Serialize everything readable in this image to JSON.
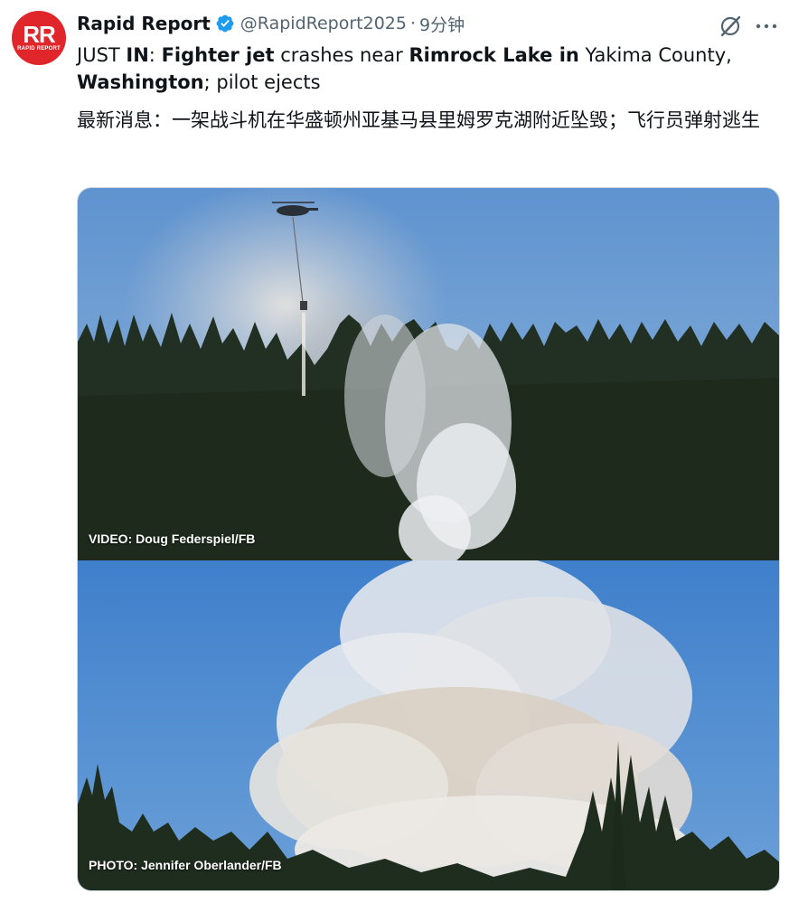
{
  "tweet": {
    "display_name": "Rapid Report",
    "handle": "@RapidReport2025",
    "separator": "·",
    "time": "9分钟",
    "avatar": {
      "initials": "RR",
      "sub_text": "RAPID REPORT",
      "color": "#e0262b"
    },
    "text_segments": [
      {
        "text": "JUST ",
        "bold": false
      },
      {
        "text": "IN",
        "bold": true
      },
      {
        "text": ": ",
        "bold": false
      },
      {
        "text": "Fighter jet",
        "bold": true
      },
      {
        "text": " crashes near ",
        "bold": false
      },
      {
        "text": "Rimrock Lake in",
        "bold": true
      },
      {
        "text": " Yakima County,",
        "bold": false
      },
      {
        "text": "Washington",
        "bold": true
      },
      {
        "text": "; pilot ejects",
        "bold": false
      }
    ],
    "translation": "最新消息：一架战斗机在华盛顿州亚基马县里姆罗克湖附近坠毁；飞行员弹射逃生",
    "media": {
      "top_credit": "VIDEO: Doug Federspiel/FB",
      "bottom_credit": "PHOTO: Jennifer Oberlander/FB"
    },
    "icons": {
      "verified": "verified-badge-icon",
      "grok": "grok-icon",
      "more": "more-icon"
    },
    "colors": {
      "verified": "#1d9bf0",
      "secondary_text": "#536471",
      "sky": "#6a9fd8",
      "smoke": "#d8d6d2"
    }
  }
}
